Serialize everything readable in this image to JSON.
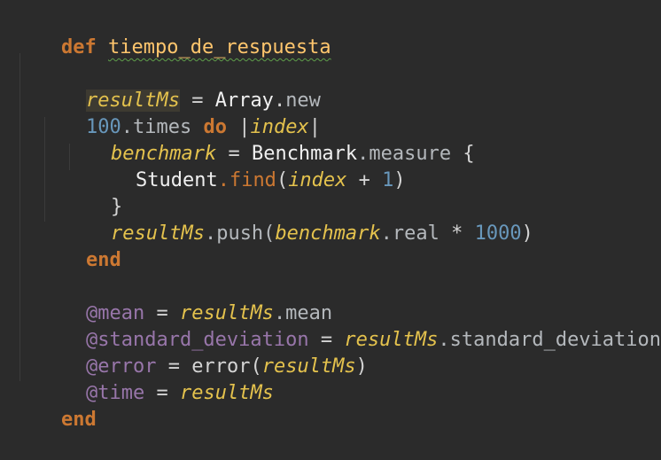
{
  "colors": {
    "background": "#2b2b2b",
    "keyword": "#cc7832",
    "method_def": "#ffc66d",
    "variable": "#e4c24d",
    "number": "#6897bb",
    "instance_var": "#9876aa",
    "default_text": "#d4d4d4"
  },
  "code": {
    "def_kw": "def",
    "method_name": "tiempo_de_respuesta",
    "l3": {
      "var": "resultMs",
      "op": " = ",
      "cls": "Array",
      "dot": ".",
      "meth": "new"
    },
    "l4": {
      "num": "100",
      "meth": ".times ",
      "kw": "do",
      "pipe1": " |",
      "arg": "index",
      "pipe2": "|"
    },
    "l5": {
      "var": "benchmark",
      "op": " = ",
      "cls": "Benchmark",
      "meth": ".measure",
      "brace": " {"
    },
    "l6": {
      "cls": "Student",
      "meth": ".find",
      "paren_open": "(",
      "arg": "index",
      "op": " + ",
      "num": "1",
      "paren_close": ")"
    },
    "l7": {
      "brace": "}"
    },
    "l8": {
      "var": "resultMs",
      "meth": ".push(",
      "var2": "benchmark",
      "meth2": ".real",
      "op": " * ",
      "num": "1000",
      "paren_close": ")"
    },
    "l9": {
      "kw": "end"
    },
    "l11": {
      "ivar": "@mean",
      "op": " = ",
      "var": "resultMs",
      "meth": ".mean"
    },
    "l12": {
      "ivar": "@standard_deviation",
      "op": " = ",
      "var": "resultMs",
      "meth": ".standard_deviation"
    },
    "l13": {
      "ivar": "@error",
      "op": " = ",
      "call": "error(",
      "var": "resultMs",
      "paren_close": ")"
    },
    "l14": {
      "ivar": "@time",
      "op": " = ",
      "var": "resultMs"
    },
    "l15": {
      "kw": "end"
    }
  }
}
